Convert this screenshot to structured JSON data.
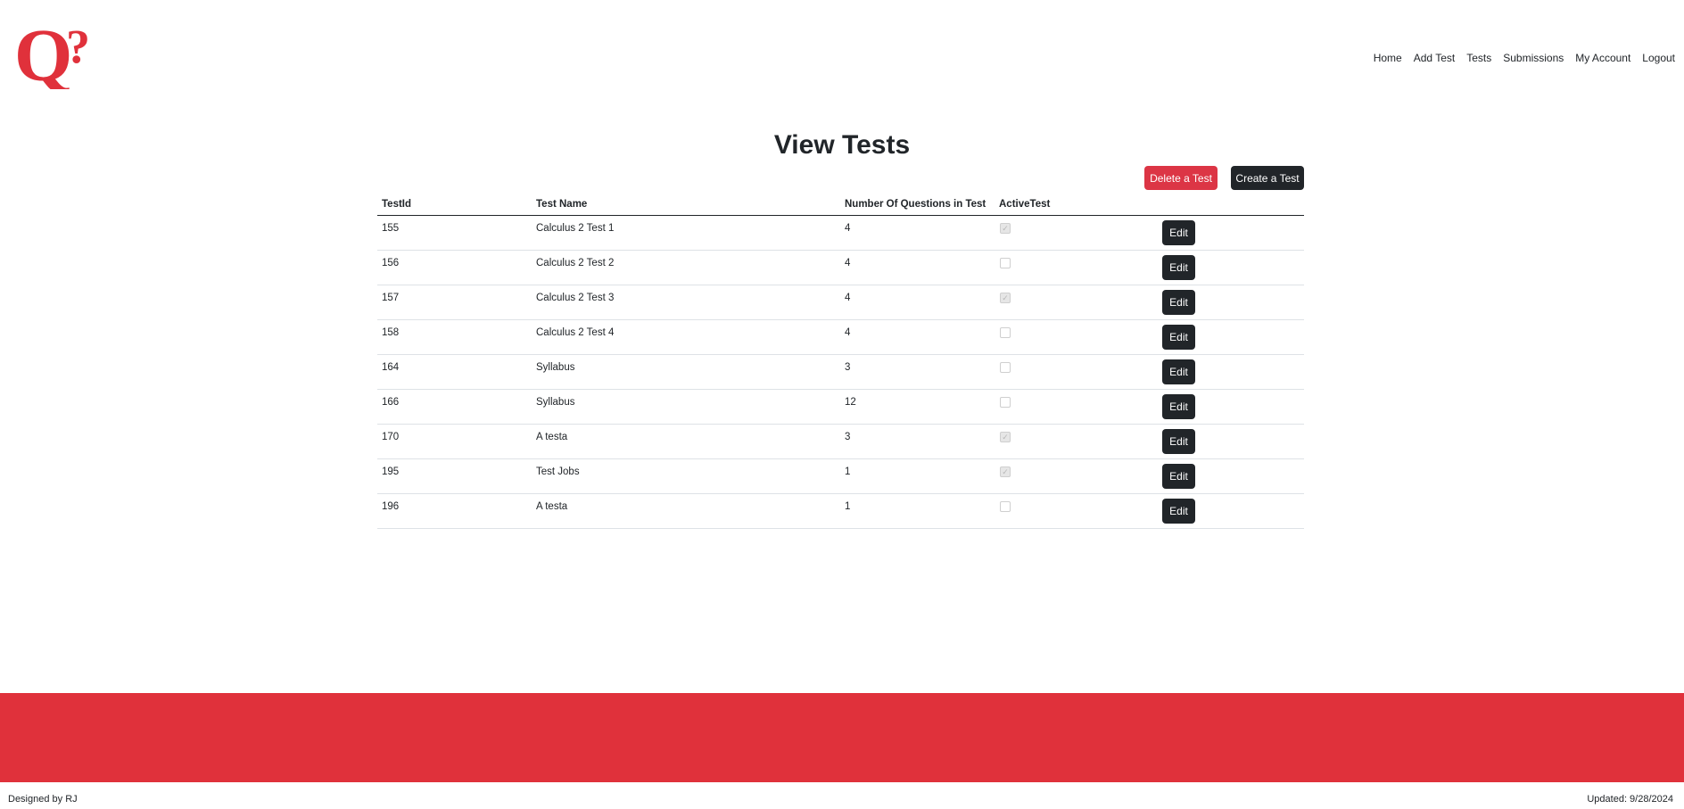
{
  "brand": {
    "logo_icon": "q-question-mark-logo-icon",
    "color": "#dc3545"
  },
  "nav": {
    "items": [
      {
        "label": "Home"
      },
      {
        "label": "Add Test"
      },
      {
        "label": "Tests"
      },
      {
        "label": "Submissions"
      },
      {
        "label": "My Account"
      },
      {
        "label": "Logout"
      }
    ]
  },
  "page": {
    "title": "View Tests"
  },
  "actions": {
    "delete_label": "Delete a Test",
    "create_label": "Create a Test"
  },
  "table": {
    "headers": [
      "TestId",
      "Test Name",
      "Number Of Questions in Test",
      "ActiveTest",
      ""
    ],
    "edit_label": "Edit",
    "rows": [
      {
        "id": "155",
        "name": "Calculus 2 Test 1",
        "questions": "4",
        "active": true
      },
      {
        "id": "156",
        "name": "Calculus 2 Test 2",
        "questions": "4",
        "active": false
      },
      {
        "id": "157",
        "name": "Calculus 2 Test 3",
        "questions": "4",
        "active": true
      },
      {
        "id": "158",
        "name": "Calculus 2 Test 4",
        "questions": "4",
        "active": false
      },
      {
        "id": "164",
        "name": "Syllabus",
        "questions": "3",
        "active": false
      },
      {
        "id": "166",
        "name": "Syllabus",
        "questions": "12",
        "active": false
      },
      {
        "id": "170",
        "name": "A testa",
        "questions": "3",
        "active": true
      },
      {
        "id": "195",
        "name": "Test Jobs",
        "questions": "1",
        "active": true
      },
      {
        "id": "196",
        "name": "A testa",
        "questions": "1",
        "active": false
      }
    ]
  },
  "footer": {
    "designer": "Designed by RJ",
    "updated": "Updated: 9/28/2024",
    "band_color": "#e0313b"
  }
}
